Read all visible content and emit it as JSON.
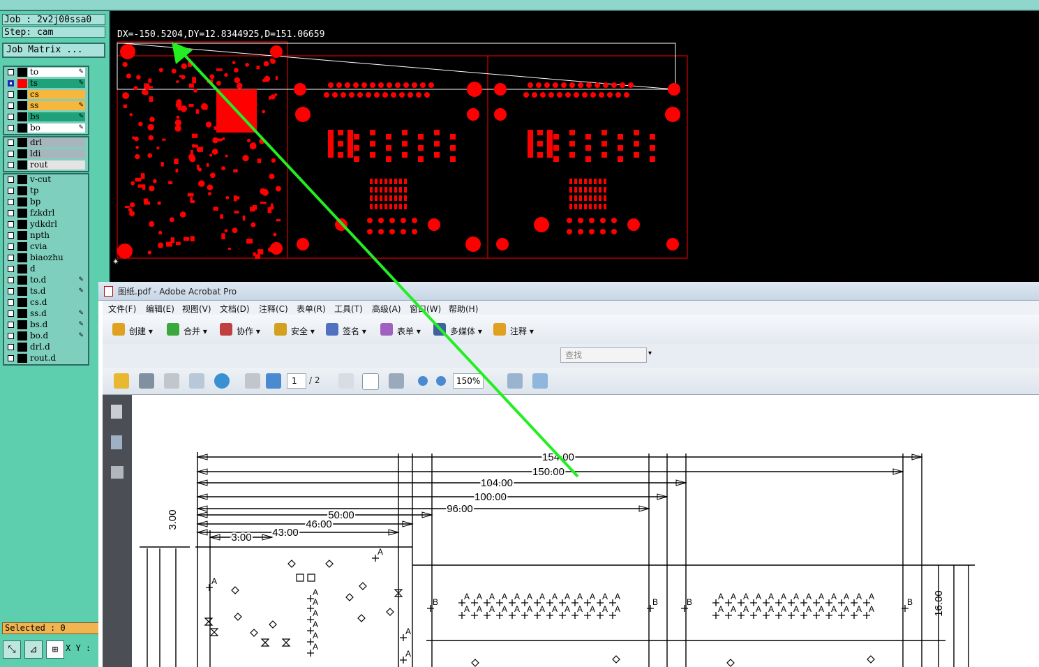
{
  "cam": {
    "job": "Job : 2v2j00ssa0",
    "step": "Step: cam",
    "job_matrix": "Job Matrix ...",
    "measure": "DX=-150.5204,DY=12.8344925,D=151.06659",
    "selected": "Selected : 0",
    "xy_label": "X Y :",
    "layer_groups": [
      [
        {
          "name": "to",
          "color": "#ffffff",
          "swatch": "#000000",
          "pen": true,
          "selected": false
        },
        {
          "name": "ts",
          "color": "#1fa27a",
          "swatch": "#ff0000",
          "pen": true,
          "selected": true
        },
        {
          "name": "cs",
          "color": "#f7b63c",
          "swatch": "#000000",
          "pen": false,
          "selected": false
        },
        {
          "name": "ss",
          "color": "#f7b63c",
          "swatch": "#000000",
          "pen": true,
          "selected": false
        },
        {
          "name": "bs",
          "color": "#1fa27a",
          "swatch": "#000000",
          "pen": true,
          "selected": false
        },
        {
          "name": "bo",
          "color": "#ffffff",
          "swatch": "#000000",
          "pen": true,
          "selected": false
        }
      ],
      [
        {
          "name": "drl",
          "color": "#a9b5bd",
          "swatch": "#000000",
          "pen": false,
          "selected": false
        },
        {
          "name": "ldi",
          "color": "#a9b5bd",
          "swatch": "#000000",
          "pen": false,
          "selected": false
        },
        {
          "name": "rout",
          "color": "#e4e4e4",
          "swatch": "#000000",
          "pen": false,
          "selected": false
        }
      ],
      [
        {
          "name": "v-cut",
          "color": "#7fcfbe",
          "swatch": "#000000",
          "pen": false,
          "selected": false
        },
        {
          "name": "tp",
          "color": "#7fcfbe",
          "swatch": "#000000",
          "pen": false,
          "selected": false
        },
        {
          "name": "bp",
          "color": "#7fcfbe",
          "swatch": "#000000",
          "pen": false,
          "selected": false
        },
        {
          "name": "fzkdrl",
          "color": "#7fcfbe",
          "swatch": "#000000",
          "pen": false,
          "selected": false
        },
        {
          "name": "ydkdrl",
          "color": "#7fcfbe",
          "swatch": "#000000",
          "pen": false,
          "selected": false
        },
        {
          "name": "npth",
          "color": "#7fcfbe",
          "swatch": "#000000",
          "pen": false,
          "selected": false
        },
        {
          "name": "cvia",
          "color": "#7fcfbe",
          "swatch": "#000000",
          "pen": false,
          "selected": false
        },
        {
          "name": "biaozhu",
          "color": "#7fcfbe",
          "swatch": "#000000",
          "pen": false,
          "selected": false
        },
        {
          "name": "d",
          "color": "#7fcfbe",
          "swatch": "#000000",
          "pen": false,
          "selected": false
        },
        {
          "name": "to.d",
          "color": "#7fcfbe",
          "swatch": "#000000",
          "pen": true,
          "selected": false
        },
        {
          "name": "ts.d",
          "color": "#7fcfbe",
          "swatch": "#000000",
          "pen": true,
          "selected": false
        },
        {
          "name": "cs.d",
          "color": "#7fcfbe",
          "swatch": "#000000",
          "pen": false,
          "selected": false
        },
        {
          "name": "ss.d",
          "color": "#7fcfbe",
          "swatch": "#000000",
          "pen": true,
          "selected": false
        },
        {
          "name": "bs.d",
          "color": "#7fcfbe",
          "swatch": "#000000",
          "pen": true,
          "selected": false
        },
        {
          "name": "bo.d",
          "color": "#7fcfbe",
          "swatch": "#000000",
          "pen": true,
          "selected": false
        },
        {
          "name": "drl.d",
          "color": "#7fcfbe",
          "swatch": "#000000",
          "pen": false,
          "selected": false
        },
        {
          "name": "rout.d",
          "color": "#7fcfbe",
          "swatch": "#000000",
          "pen": false,
          "selected": false
        }
      ]
    ],
    "pcb_color": "#ff0000"
  },
  "acrobat": {
    "title": "图纸.pdf - Adobe Acrobat Pro",
    "menu": [
      "文件(F)",
      "编辑(E)",
      "视图(V)",
      "文档(D)",
      "注释(C)",
      "表单(R)",
      "工具(T)",
      "高级(A)",
      "窗口(W)",
      "帮助(H)"
    ],
    "toolbar": [
      {
        "label": "创建 ▾",
        "icon": "create-icon",
        "color": "#e0a020"
      },
      {
        "label": "合并 ▾",
        "icon": "combine-icon",
        "color": "#3aa83a"
      },
      {
        "label": "协作 ▾",
        "icon": "collaborate-icon",
        "color": "#c04040"
      },
      {
        "label": "安全 ▾",
        "icon": "lock-icon",
        "color": "#d4a020"
      },
      {
        "label": "签名 ▾",
        "icon": "sign-pen-icon",
        "color": "#5070c0"
      },
      {
        "label": "表单 ▾",
        "icon": "form-icon",
        "color": "#a060c0"
      },
      {
        "label": "多媒体 ▾",
        "icon": "multimedia-icon",
        "color": "#4060a0"
      },
      {
        "label": "注释 ▾",
        "icon": "comment-icon",
        "color": "#e0a020"
      }
    ],
    "find_placeholder": "查找",
    "page_current": "1",
    "page_total": "/ 2",
    "zoom": "150%"
  },
  "drawing": {
    "dimensions": [
      "154.00",
      "150.00",
      "104.00",
      "100.00",
      "96.00",
      "50.00",
      "46.00",
      "43.00",
      "3.00",
      "3.00",
      "16.00"
    ],
    "marker_a": "A",
    "marker_b": "B"
  }
}
